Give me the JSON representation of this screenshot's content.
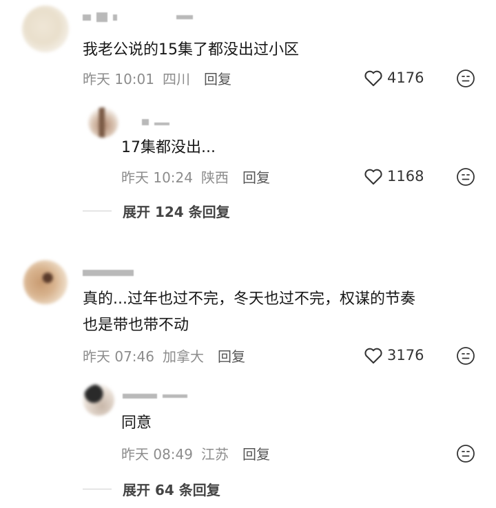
{
  "comments": [
    {
      "text": "我老公说的15集了都没出过小区",
      "time": "昨天 10:01",
      "location": "四川",
      "reply_label": "回复",
      "likes": "4176",
      "replies": [
        {
          "text": "17集都没出...",
          "time": "昨天 10:24",
          "location": "陕西",
          "reply_label": "回复",
          "likes": "1168"
        }
      ],
      "expand_label": "展开 124 条回复"
    },
    {
      "text_line1": "真的...过年也过不完，冬天也过不完，权谋的节奏",
      "text_line2": "也是带也带不动",
      "time": "昨天 07:46",
      "location": "加拿大",
      "reply_label": "回复",
      "likes": "3176",
      "replies": [
        {
          "text": "同意",
          "time": "昨天 08:49",
          "location": "江苏",
          "reply_label": "回复"
        }
      ],
      "expand_label": "展开 64 条回复"
    }
  ],
  "icons": {
    "like": "heart-outline-icon",
    "dislike": "meh-face-icon"
  },
  "colors": {
    "text": "#171717",
    "meta": "#8c8c8c",
    "icon": "#333333"
  }
}
